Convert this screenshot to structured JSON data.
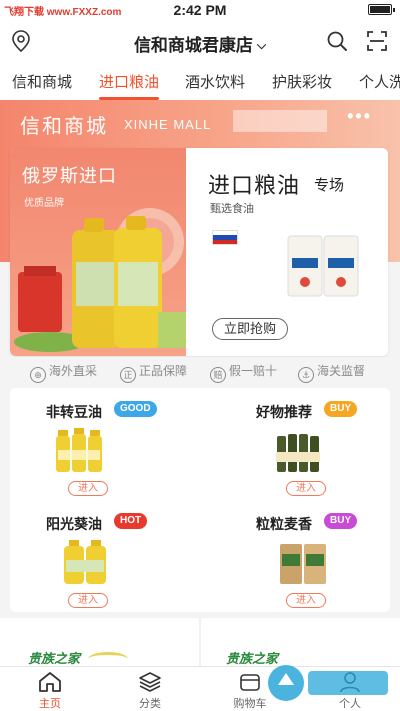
{
  "status_bar": {
    "watermark": "飞翔下载 www.FXXZ.com",
    "time": "2:42 PM"
  },
  "header": {
    "store_name": "信和商城君康店",
    "icons": [
      "location-icon",
      "search-icon",
      "scan-icon"
    ]
  },
  "tabs": [
    {
      "label": "信和商城",
      "active": false
    },
    {
      "label": "进口粮油",
      "active": true
    },
    {
      "label": "酒水饮料",
      "active": false
    },
    {
      "label": "护肤彩妆",
      "active": false
    },
    {
      "label": "个人洗",
      "active": false
    }
  ],
  "banner": {
    "brand_cn": "信和商城",
    "brand_en": "XINHE MALL",
    "more": "•••"
  },
  "promo": {
    "origin": "俄罗斯进口",
    "origin_tag": "优质品牌",
    "title": "进口粮油",
    "title_suffix": "专场",
    "subtitle": "甄选食油",
    "button": "立即抢购",
    "flag_colors": [
      "#ffffff",
      "#1f4bb5",
      "#d52b1e"
    ]
  },
  "guarantees": [
    {
      "icon": "globe-icon",
      "glyph": "⊕",
      "label": "海外直采"
    },
    {
      "icon": "genuine-icon",
      "glyph": "正",
      "label": "正品保障"
    },
    {
      "icon": "compensate-icon",
      "glyph": "赔",
      "label": "假一赔十"
    },
    {
      "icon": "customs-icon",
      "glyph": "⚓",
      "label": "海关监督"
    }
  ],
  "products": [
    {
      "name": "非转豆油",
      "badge": "GOOD",
      "badge_color": "#3fa7e6",
      "button": "进入"
    },
    {
      "name": "好物推荐",
      "badge": "BUY",
      "badge_color": "#f5a623",
      "button": "进入"
    },
    {
      "name": "阳光葵油",
      "badge": "HOT",
      "badge_color": "#e8392f",
      "button": "进入"
    },
    {
      "name": "粒粒麦香",
      "badge": "BUY",
      "badge_color": "#c84bd6",
      "button": "进入"
    }
  ],
  "brand_cards": [
    {
      "label": "贵族之家"
    },
    {
      "label": "贵族之家"
    }
  ],
  "bottom_nav": [
    {
      "label": "主页",
      "icon": "home-icon",
      "active": true
    },
    {
      "label": "分类",
      "icon": "layers-icon",
      "active": false
    },
    {
      "label": "购物车",
      "icon": "cart-icon",
      "active": false
    },
    {
      "label": "个人",
      "icon": "user-icon",
      "active": false
    }
  ],
  "accent": "#f0522d"
}
